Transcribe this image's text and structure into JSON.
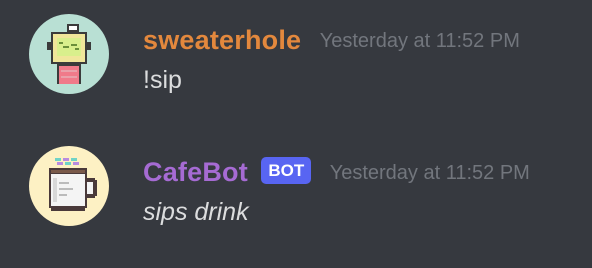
{
  "messages": [
    {
      "author": "sweaterhole",
      "author_color": "#e3883d",
      "timestamp": "Yesterday at 11:52 PM",
      "content": "!sip",
      "avatar_icon": "pixel-robot-avatar-icon",
      "avatar_bg": "#b9e0d4"
    },
    {
      "author": "CafeBot",
      "author_color": "#a66bd3",
      "bot_tag": "BOT",
      "timestamp": "Yesterday at 11:52 PM",
      "content": "sips drink",
      "avatar_icon": "coffee-mug-avatar-icon",
      "avatar_bg": "#fdf1c4"
    }
  ],
  "colors": {
    "background": "#36393f",
    "timestamp": "#72767d",
    "message_text": "#dcddde",
    "bot_tag_bg": "#5865f2"
  }
}
